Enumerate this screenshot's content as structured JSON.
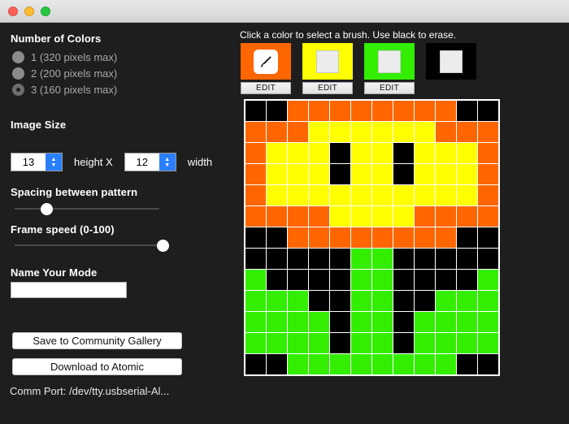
{
  "window": {
    "traffic_lights": [
      {
        "name": "close-button",
        "color": "#ff5f57"
      },
      {
        "name": "minimize-button",
        "color": "#febc2e"
      },
      {
        "name": "maximize-button",
        "color": "#28c840"
      }
    ]
  },
  "sidebar": {
    "colors_section": {
      "title": "Number of Colors",
      "options": [
        {
          "label": "1 (320 pixels max)",
          "value": "1",
          "checked": false
        },
        {
          "label": "2 (200 pixels max)",
          "value": "2",
          "checked": false
        },
        {
          "label": "3 (160 pixels max)",
          "value": "3",
          "checked": true
        }
      ]
    },
    "image_size": {
      "title": "Image Size",
      "height_value": "13",
      "height_label": "height X",
      "width_value": "12",
      "width_label": "width"
    },
    "spacing": {
      "title": "Spacing between pattern",
      "percent": 22
    },
    "frame_speed": {
      "title": "Frame speed (0-100)",
      "percent": 96
    },
    "name_field": {
      "title": "Name Your Mode",
      "value": "",
      "placeholder": ""
    },
    "buttons": {
      "save_label": "Save to Community Gallery",
      "download_label": "Download to Atomic"
    },
    "comm_port": "Comm Port: /dev/tty.usbserial-Al..."
  },
  "editor": {
    "hint": "Click a color to select a brush.  Use black to erase.",
    "edit_label": "EDIT",
    "swatches": [
      {
        "name": "swatch-orange",
        "color": "#ff6600",
        "selected": true,
        "has_edit": true
      },
      {
        "name": "swatch-yellow",
        "color": "#ffff00",
        "selected": false,
        "has_edit": true
      },
      {
        "name": "swatch-green",
        "color": "#33ee00",
        "selected": false,
        "has_edit": true
      },
      {
        "name": "swatch-black",
        "color": "#000000",
        "selected": false,
        "has_edit": false
      }
    ],
    "palette": {
      "K": "#000000",
      "O": "#ff6600",
      "Y": "#ffff00",
      "G": "#33ee00"
    },
    "grid": {
      "rows": 13,
      "cols": 12,
      "cell_size": 25,
      "pixels": [
        [
          "K",
          "K",
          "O",
          "O",
          "O",
          "O",
          "O",
          "O",
          "O",
          "O",
          "K",
          "K"
        ],
        [
          "O",
          "O",
          "O",
          "Y",
          "Y",
          "Y",
          "Y",
          "Y",
          "Y",
          "O",
          "O",
          "O"
        ],
        [
          "O",
          "Y",
          "Y",
          "Y",
          "K",
          "Y",
          "Y",
          "K",
          "Y",
          "Y",
          "Y",
          "O"
        ],
        [
          "O",
          "Y",
          "Y",
          "Y",
          "K",
          "Y",
          "Y",
          "K",
          "Y",
          "Y",
          "Y",
          "O"
        ],
        [
          "O",
          "Y",
          "Y",
          "Y",
          "Y",
          "Y",
          "Y",
          "Y",
          "Y",
          "Y",
          "Y",
          "O"
        ],
        [
          "O",
          "O",
          "O",
          "O",
          "Y",
          "Y",
          "Y",
          "Y",
          "O",
          "O",
          "O",
          "O"
        ],
        [
          "K",
          "K",
          "O",
          "O",
          "O",
          "O",
          "O",
          "O",
          "O",
          "O",
          "K",
          "K"
        ],
        [
          "K",
          "K",
          "K",
          "K",
          "K",
          "G",
          "G",
          "K",
          "K",
          "K",
          "K",
          "K"
        ],
        [
          "G",
          "K",
          "K",
          "K",
          "K",
          "G",
          "G",
          "K",
          "K",
          "K",
          "K",
          "G"
        ],
        [
          "G",
          "G",
          "G",
          "K",
          "K",
          "G",
          "G",
          "K",
          "K",
          "G",
          "G",
          "G"
        ],
        [
          "G",
          "G",
          "G",
          "G",
          "K",
          "G",
          "G",
          "K",
          "G",
          "G",
          "G",
          "G"
        ],
        [
          "G",
          "G",
          "G",
          "G",
          "K",
          "G",
          "G",
          "K",
          "G",
          "G",
          "G",
          "G"
        ],
        [
          "K",
          "K",
          "G",
          "G",
          "G",
          "G",
          "G",
          "G",
          "G",
          "G",
          "K",
          "K"
        ]
      ]
    }
  }
}
